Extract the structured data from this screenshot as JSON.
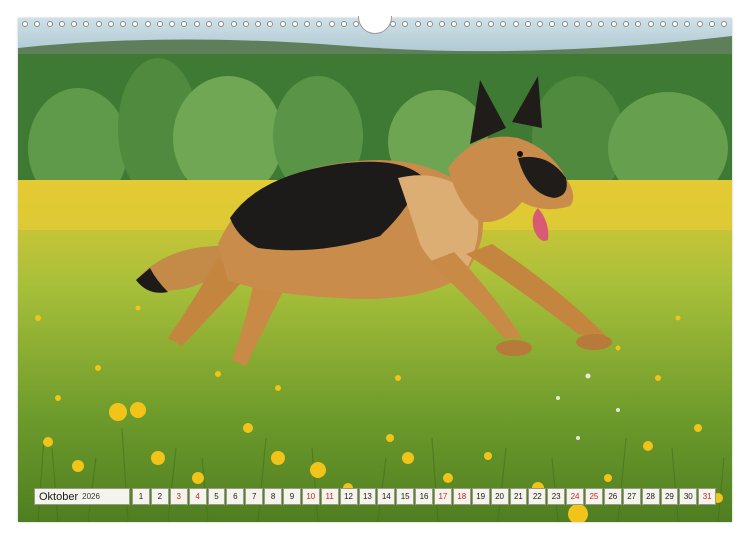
{
  "calendar": {
    "month": "Oktober",
    "year": "2026",
    "days": [
      "1",
      "2",
      "3",
      "4",
      "5",
      "6",
      "7",
      "8",
      "9",
      "10",
      "11",
      "12",
      "13",
      "14",
      "15",
      "16",
      "17",
      "18",
      "19",
      "20",
      "21",
      "22",
      "23",
      "24",
      "25",
      "26",
      "27",
      "28",
      "29",
      "30",
      "31"
    ],
    "weekend_days": [
      "3",
      "4",
      "10",
      "11",
      "17",
      "18",
      "24",
      "25",
      "31"
    ],
    "weekday_color": "#1a1a1a",
    "weekend_color": "#c0262b"
  },
  "photo": {
    "subject": "german-shepherd-running-in-meadow"
  }
}
